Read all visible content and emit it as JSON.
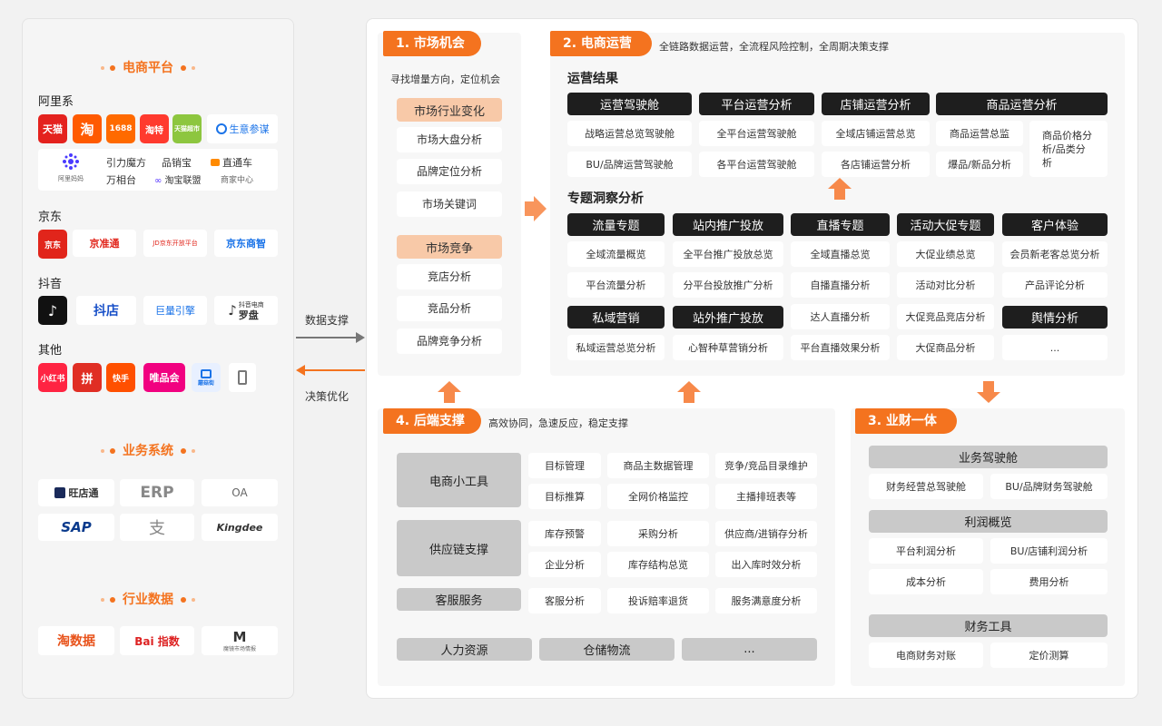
{
  "left": {
    "platform_title": "电商平台",
    "ali": {
      "label": "阿里系",
      "logos": [
        "天猫",
        "淘",
        "1688",
        "淘特",
        "天猫超市",
        "生意参谋"
      ],
      "tools": [
        "阿里妈妈",
        "引力魔方",
        "品销宝",
        "直通车",
        "万相台",
        "淘宝联盟",
        "商家中心"
      ]
    },
    "jd": {
      "label": "京东",
      "logos": [
        "京东",
        "京准通",
        "JD京东开放平台",
        "京东商智"
      ]
    },
    "douyin": {
      "label": "抖音",
      "logos": [
        "抖音",
        "抖店",
        "巨量引擎",
        "抖音电商",
        "罗盘"
      ]
    },
    "other": {
      "label": "其他",
      "logos": [
        "小红书",
        "拼",
        "快手",
        "唯品会",
        "蘑菇街"
      ]
    },
    "business_title": "业务系统",
    "business_logos": [
      "旺店通",
      "ERP",
      "OA",
      "SAP",
      "支",
      "Kingdee"
    ],
    "industry_title": "行业数据",
    "industry_logos": [
      "淘数据",
      "Bai 指数",
      "M",
      "魔镜市场情报"
    ]
  },
  "arrows": {
    "data_support": "数据支撑",
    "decision": "决策优化"
  },
  "s1": {
    "tab": "1. 市场机会",
    "sub": "寻找增量方向，定位机会",
    "head1": "市场行业变化",
    "items1": [
      "市场大盘分析",
      "品牌定位分析",
      "市场关键词"
    ],
    "head2": "市场竞争",
    "items2": [
      "竞店分析",
      "竞品分析",
      "品牌竞争分析"
    ]
  },
  "s2": {
    "tab": "2. 电商运营",
    "sub": "全链路数据运营，全流程风险控制，全周期决策支撑",
    "h_result": "运营结果",
    "results": [
      {
        "head": "运营驾驶舱",
        "items": [
          "战略运营总览驾驶舱",
          "BU/品牌运营驾驶舱"
        ]
      },
      {
        "head": "平台运营分析",
        "items": [
          "全平台运营驾驶舱",
          "各平台运营驾驶舱"
        ]
      },
      {
        "head": "店铺运营分析",
        "items": [
          "全域店铺运营总览",
          "各店铺运营分析"
        ]
      },
      {
        "head": "商品运营分析",
        "items": [
          "商品运营总监",
          "爆品/新品分析",
          "商品价格分析/品类分析"
        ]
      }
    ],
    "h_topic": "专题洞察分析",
    "topics": [
      {
        "head": "流量专题",
        "items": [
          "全域流量概览",
          "平台流量分析"
        ]
      },
      {
        "head": "站内推广投放",
        "items": [
          "全平台推广投放总览",
          "分平台投放推广分析"
        ]
      },
      {
        "head": "直播专题",
        "items": [
          "全域直播总览",
          "自播直播分析"
        ]
      },
      {
        "head": "活动大促专题",
        "items": [
          "大促业绩总览",
          "活动对比分析"
        ]
      },
      {
        "head": "客户体验",
        "items": [
          "会员新老客总览分析",
          "产品评论分析"
        ]
      }
    ],
    "topics2": [
      {
        "head": "私域营销",
        "items": [
          "私域运营总览分析"
        ]
      },
      {
        "head": "站外推广投放",
        "items": [
          "心智种草营销分析"
        ]
      },
      {
        "head": "达人直播分析",
        "items": [
          "平台直播效果分析"
        ]
      },
      {
        "head": "大促竞品竞店分析",
        "items": [
          "大促商品分析"
        ]
      },
      {
        "head": "舆情分析",
        "items": [
          "..."
        ]
      }
    ]
  },
  "s3": {
    "tab": "3. 业财一体",
    "g1": {
      "head": "业务驾驶舱",
      "items": [
        "财务经营总驾驶舱",
        "BU/品牌财务驾驶舱"
      ]
    },
    "g2": {
      "head": "利润概览",
      "items": [
        "平台利润分析",
        "BU/店铺利润分析",
        "成本分析",
        "费用分析"
      ]
    },
    "g3": {
      "head": "财务工具",
      "items": [
        "电商财务对账",
        "定价测算"
      ]
    }
  },
  "s4": {
    "tab": "4. 后端支撑",
    "sub": "高效协同，急速反应，稳定支撑",
    "tools": {
      "head": "电商小工具",
      "items": [
        "目标管理",
        "商品主数据管理",
        "竞争/竞品目录维护",
        "目标推算",
        "全网价格监控",
        "主播排班表等"
      ]
    },
    "supply": {
      "head": "供应链支撑",
      "items": [
        "库存预警",
        "采购分析",
        "供应商/进销存分析",
        "企业分析",
        "库存结构总览",
        "出入库时效分析"
      ]
    },
    "service": {
      "head": "客服服务",
      "items": [
        "客服分析",
        "投诉赔率退货",
        "服务满意度分析"
      ]
    },
    "bottom": [
      "人力资源",
      "仓储物流",
      "..."
    ]
  },
  "colors": {
    "accent": "#f4731f",
    "dark": "#1e1e1e",
    "grey": "#c9c9c9",
    "peach": "#f8c9a8"
  }
}
